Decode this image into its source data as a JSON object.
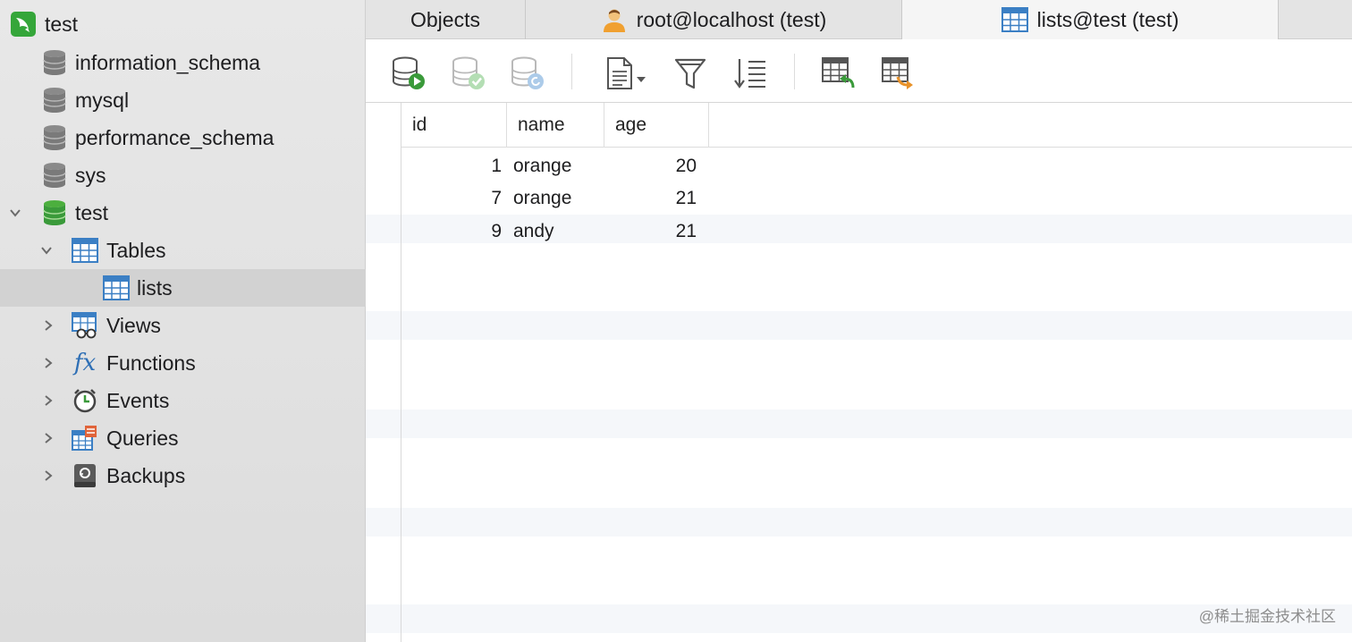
{
  "sidebar": {
    "connection": {
      "label": "test"
    },
    "databases": [
      {
        "label": "information_schema"
      },
      {
        "label": "mysql"
      },
      {
        "label": "performance_schema"
      },
      {
        "label": "sys"
      },
      {
        "label": "test"
      }
    ],
    "groups": {
      "tables": {
        "label": "Tables"
      },
      "lists": {
        "label": "lists"
      },
      "views": {
        "label": "Views"
      },
      "functions": {
        "label": "Functions"
      },
      "events": {
        "label": "Events"
      },
      "queries": {
        "label": "Queries"
      },
      "backups": {
        "label": "Backups"
      }
    }
  },
  "tabs": [
    {
      "label": "Objects"
    },
    {
      "label": "root@localhost (test)"
    },
    {
      "label": "lists@test (test)",
      "active": true
    }
  ],
  "grid": {
    "columns": [
      "id",
      "name",
      "age"
    ],
    "rows": [
      {
        "id": "1",
        "name": "orange",
        "age": "20"
      },
      {
        "id": "7",
        "name": "orange",
        "age": "21"
      },
      {
        "id": "9",
        "name": "andy",
        "age": "21"
      }
    ]
  },
  "watermark": "@稀土掘金技术社区",
  "colors": {
    "accent_green": "#3a9a3a",
    "table_blue": "#3b7fc4"
  }
}
